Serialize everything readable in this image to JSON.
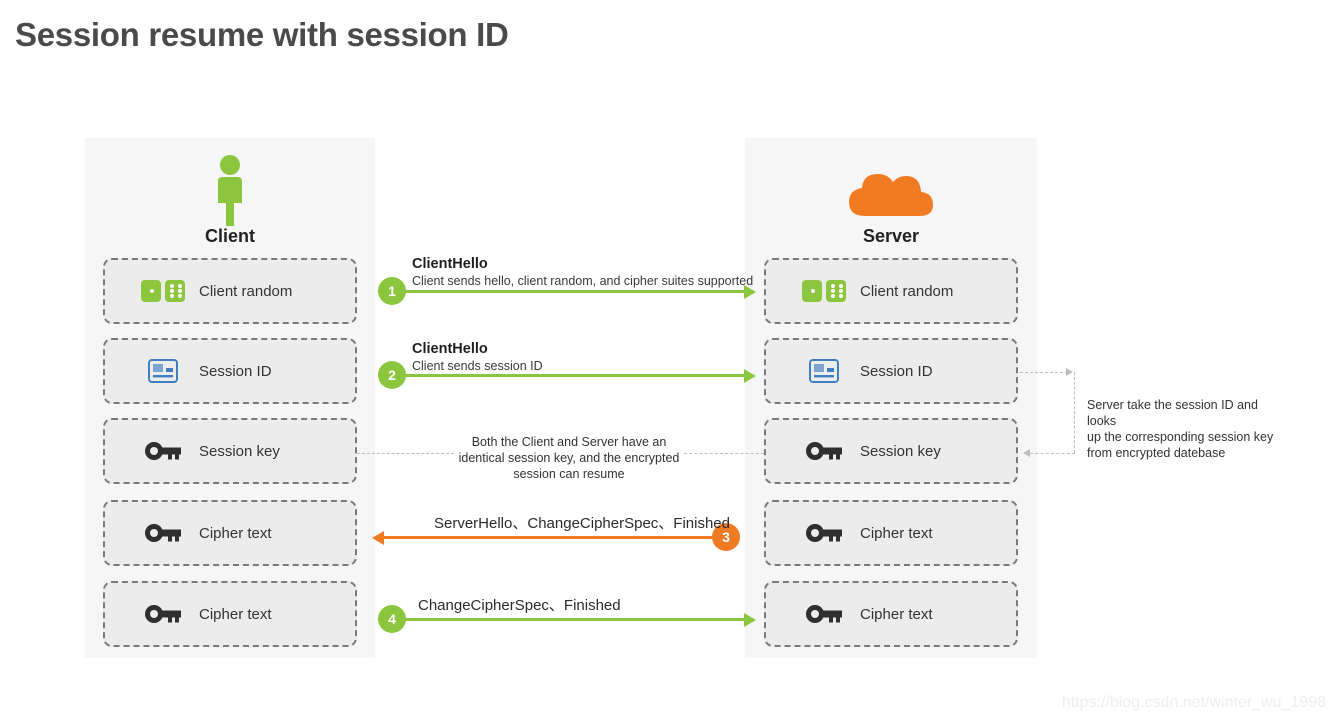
{
  "title": "Session resume with session ID",
  "watermark": "https://blog.csdn.net/winter_wu_1998",
  "colors": {
    "green": "#8cc63e",
    "orange": "#f07b22",
    "blue": "#3f7fc1",
    "key_gray": "#2f2f2f",
    "panel_bg": "#f6f6f6",
    "box_bg": "#ececec",
    "box_border": "#7a7a7a",
    "dash_gray": "#bdbdbd"
  },
  "client": {
    "label": "Client",
    "icon": "person-icon",
    "items": [
      {
        "label": "Client random",
        "icon": "dice-icon"
      },
      {
        "label": "Session ID",
        "icon": "id-card-icon"
      },
      {
        "label": "Session key",
        "icon": "key-icon"
      },
      {
        "label": "Cipher text",
        "icon": "key-icon"
      },
      {
        "label": "Cipher text",
        "icon": "key-icon"
      }
    ]
  },
  "server": {
    "label": "Server",
    "icon": "cloud-icon",
    "items": [
      {
        "label": "Client random",
        "icon": "dice-icon"
      },
      {
        "label": "Session ID",
        "icon": "id-card-icon"
      },
      {
        "label": "Session key",
        "icon": "key-icon"
      },
      {
        "label": "Cipher text",
        "icon": "key-icon"
      },
      {
        "label": "Cipher text",
        "icon": "key-icon"
      }
    ]
  },
  "steps": [
    {
      "number": "1",
      "title": "ClientHello",
      "subtitle": "Client sends hello, client random, and cipher suites supported",
      "direction": "client-to-server",
      "color": "#8cc63e"
    },
    {
      "number": "2",
      "title": "ClientHello",
      "subtitle": "Client sends session ID",
      "direction": "client-to-server",
      "color": "#8cc63e"
    },
    {
      "number": "3",
      "title": "ServerHello、ChangeCipherSpec、Finished",
      "subtitle": "",
      "direction": "server-to-client",
      "color": "#f07b22"
    },
    {
      "number": "4",
      "title": "ChangeCipherSpec、Finished",
      "subtitle": "",
      "direction": "client-to-server",
      "color": "#8cc63e"
    }
  ],
  "notes": {
    "center": "Both the Client and Server have an identical session key, and the encrypted session can resume",
    "center_lines": [
      "Both the Client and Server have an",
      "identical session key, and the encrypted",
      "session can resume"
    ],
    "right": "Server take the session ID and looks up the corresponding session key from encrypted datebase",
    "right_lines": [
      "Server take the session ID and looks",
      "up the corresponding session key",
      "from encrypted datebase"
    ]
  }
}
